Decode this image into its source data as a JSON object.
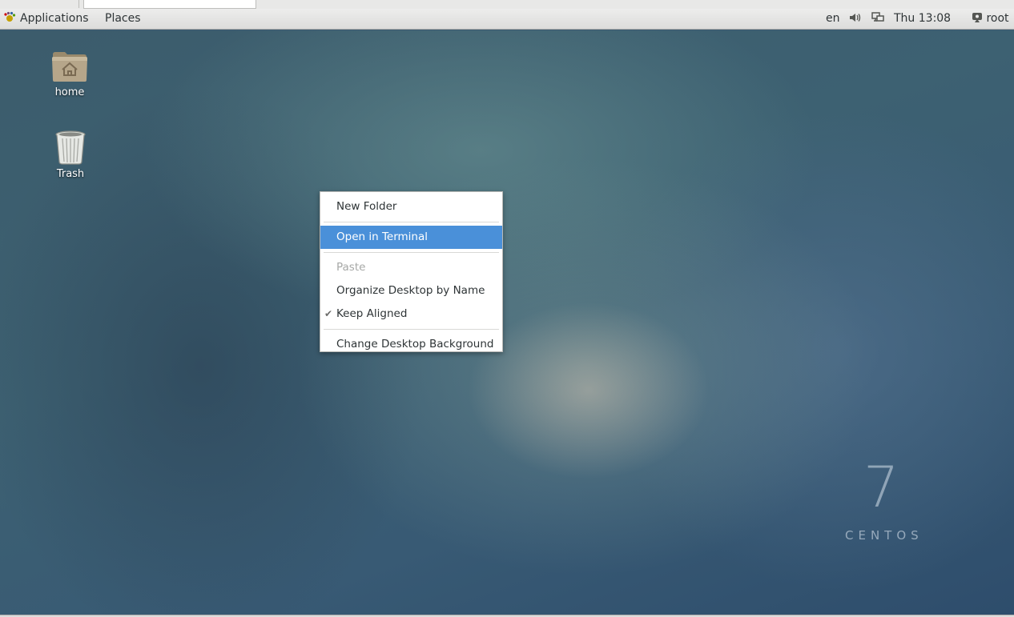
{
  "panel": {
    "applications_label": "Applications",
    "places_label": "Places",
    "language": "en",
    "clock": "Thu 13:08",
    "user": "root",
    "icons": [
      "gnome-foot-icon",
      "volume-icon",
      "network-icon",
      "user-icon"
    ]
  },
  "desktop": {
    "icons": [
      {
        "label": "home",
        "icon": "home-folder-icon"
      },
      {
        "label": "Trash",
        "icon": "trash-icon"
      }
    ],
    "watermark": {
      "number": "7",
      "word": "CENTOS"
    }
  },
  "context_menu": {
    "items": [
      {
        "label": "New Folder",
        "state": "normal"
      },
      {
        "label": "Open in Terminal",
        "state": "highlighted"
      },
      {
        "label": "Paste",
        "state": "disabled"
      },
      {
        "label": "Organize Desktop by Name",
        "state": "normal"
      },
      {
        "label": "Keep Aligned",
        "state": "checked"
      },
      {
        "label": "Change Desktop Background",
        "state": "normal"
      }
    ],
    "highlight_color": "#4a90d9"
  }
}
